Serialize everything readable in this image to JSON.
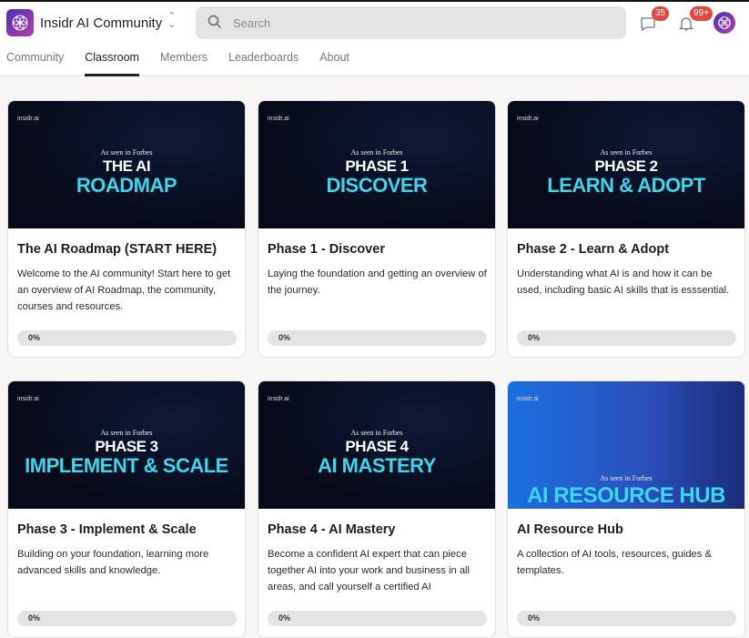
{
  "header": {
    "community_name": "Insidr AI Community",
    "search_placeholder": "Search",
    "messages_badge": "35",
    "notifications_badge": "99+"
  },
  "tabs": [
    {
      "label": "Community"
    },
    {
      "label": "Classroom",
      "active": true
    },
    {
      "label": "Members"
    },
    {
      "label": "Leaderboards"
    },
    {
      "label": "About"
    }
  ],
  "colors": {
    "accent": "#3ad7ee",
    "badge": "#e4473c",
    "brand_gradient": [
      "#4b2fb8",
      "#b23fa8"
    ]
  },
  "courses": [
    {
      "thumb": {
        "logo": "insidr.ai",
        "forbes": "As seen in Forbes",
        "line1": "THE AI",
        "line2": "ROADMAP"
      },
      "title": "The AI Roadmap (START HERE)",
      "description": "Welcome to the AI community! Start here to get an overview of AI Roadmap, the community, courses and resources.",
      "progress": 0,
      "progress_label": "0%"
    },
    {
      "thumb": {
        "logo": "insidr.ai",
        "forbes": "As seen in Forbes",
        "line1": "PHASE 1",
        "line2": "DISCOVER"
      },
      "title": "Phase 1 - Discover",
      "description": "Laying the foundation and getting an overview of the journey.",
      "progress": 0,
      "progress_label": "0%"
    },
    {
      "thumb": {
        "logo": "insidr.ai",
        "forbes": "As seen in Forbes",
        "line1": "PHASE 2",
        "line2": "LEARN & ADOPT"
      },
      "title": "Phase 2 - Learn & Adopt",
      "description": "Understanding what AI is and how it can be used, including basic AI skills that is esssential.",
      "progress": 0,
      "progress_label": "0%"
    },
    {
      "thumb": {
        "logo": "insidr.ai",
        "forbes": "As seen in Forbes",
        "line1": "PHASE 3",
        "line2": "IMPLEMENT & SCALE"
      },
      "title": "Phase 3 - Implement & Scale",
      "description": "Building on your foundation, learning more advanced skills and knowledge.",
      "progress": 0,
      "progress_label": "0%"
    },
    {
      "thumb": {
        "logo": "insidr.ai",
        "forbes": "As seen in Forbes",
        "line1": "PHASE 4",
        "line2": "AI MASTERY"
      },
      "title": "Phase 4 - AI Mastery",
      "description": "Become a confident AI expert that can piece together AI into your work and business in all areas, and call yourself a certified AI",
      "progress": 0,
      "progress_label": "0%"
    },
    {
      "thumb": {
        "logo": "insidr.ai",
        "forbes": "As seen in Forbes",
        "line1": "",
        "line2": "AI RESOURCE HUB"
      },
      "title": "AI Resource Hub",
      "description": "A collection of AI tools, resources, guides & templates.",
      "progress": 0,
      "progress_label": "0%"
    }
  ]
}
